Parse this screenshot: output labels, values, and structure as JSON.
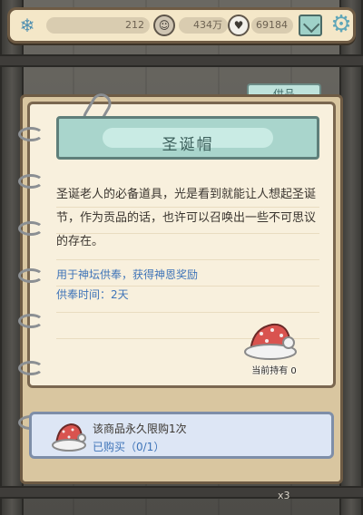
{
  "resources": {
    "coins": "212",
    "gems": "434万",
    "souls": "69184"
  },
  "icons": {
    "snow": "snowflake-icon",
    "mail": "mail-icon",
    "settings": "gear-icon"
  },
  "tab": {
    "label": "供品"
  },
  "item": {
    "name": "圣诞帽",
    "description": "圣诞老人的必备道具，光是看到就能让人想起圣诞节，作为贡品的话，也许可以召唤出一些不可思议的存在。",
    "effect": "用于神坛供奉，获得神恩奖励",
    "duration": "供奉时间：2天",
    "owned": "当前持有 0"
  },
  "purchase": {
    "limit": "该商品永久限购1次",
    "bought": "已购买（0/1）"
  },
  "background": {
    "count": "x3"
  },
  "colors": {
    "accent_teal": "#a9d5cc",
    "text_blue": "#3f74b8",
    "paper": "#f8f0dd",
    "frame": "#6e5b44"
  }
}
